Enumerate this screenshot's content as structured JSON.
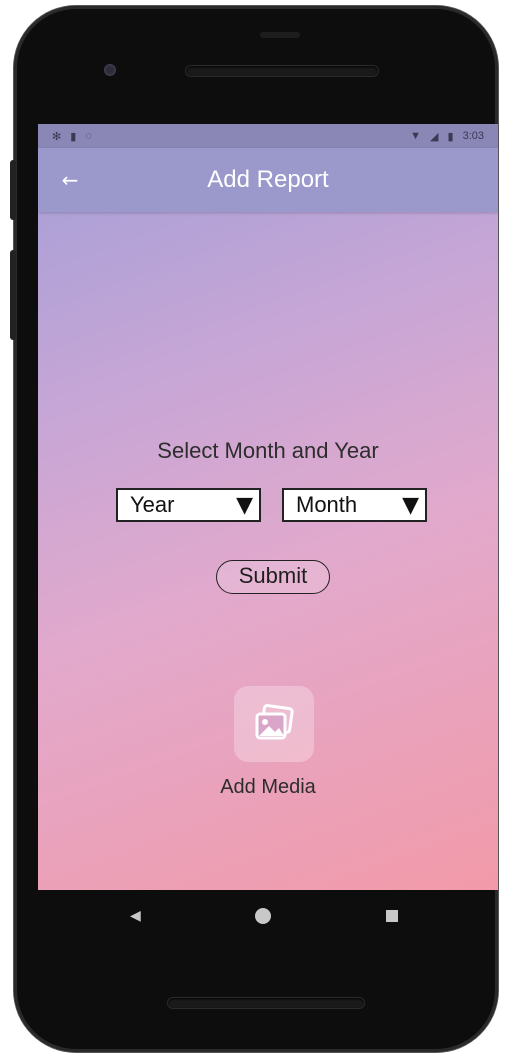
{
  "status_bar": {
    "left_icons": [
      "settings-icon",
      "sim-icon",
      "sync-icon"
    ],
    "right_icons": [
      "wifi-icon",
      "signal-icon",
      "battery-icon"
    ],
    "time": "3:03"
  },
  "app_bar": {
    "title": "Add Report",
    "back_icon": "arrow-left-icon"
  },
  "form": {
    "prompt": "Select Month and Year",
    "year_select": {
      "selected": "Year"
    },
    "month_select": {
      "selected": "Month"
    },
    "submit_label": "Submit"
  },
  "media": {
    "label": "Add Media",
    "icon": "images-icon"
  },
  "nav_bar": {
    "buttons": [
      "back-triangle-icon",
      "home-circle-icon",
      "recents-square-icon"
    ]
  },
  "colors": {
    "app_bar": "#9b99cc",
    "gradient_start": "#a29ed6",
    "gradient_end": "#f29aa9",
    "phone_body": "#0d0d0d"
  }
}
